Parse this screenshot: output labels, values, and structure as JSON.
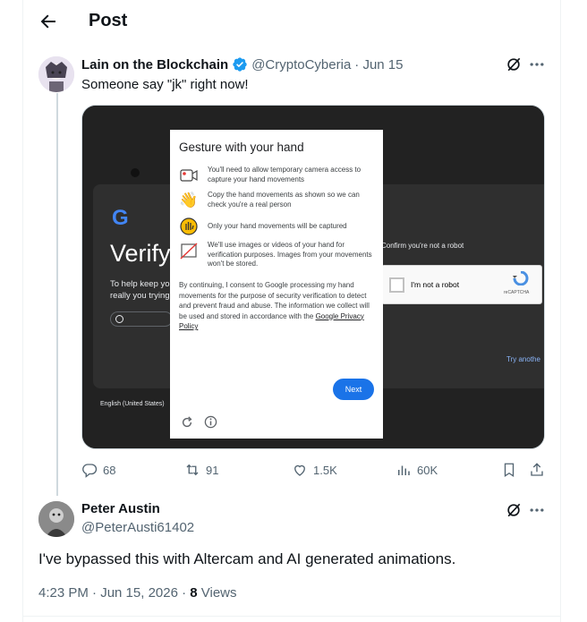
{
  "header": {
    "title": "Post"
  },
  "tweet": {
    "author_name": "Lain on the Blockchain",
    "author_handle": "@CryptoCyberia",
    "date": "· Jun 15",
    "text": "Someone say \"jk\" right now!",
    "stats": {
      "replies": "68",
      "retweets": "91",
      "likes": "1.5K",
      "views": "60K"
    }
  },
  "media": {
    "google_title": "Verify",
    "help_line1": "To help keep yo",
    "help_line2": "really you trying",
    "footer_lang": "English (United States)",
    "confirm_text": "Confirm you're not a robot",
    "captcha_label": "I'm not a robot",
    "captcha_brand": "reCAPTCHA",
    "try_another": "Try anothe",
    "dialog": {
      "title": "Gesture with your hand",
      "rows": [
        "You'll need to allow temporary camera access to capture your hand movements",
        "Copy the hand movements as shown so we can check you're a real person",
        "Only your hand movements will be captured",
        "We'll use images or videos of your hand for verification purposes. Images from your movements won't be stored."
      ],
      "consent": "By continuing, I consent to Google processing my hand movements for the purpose of security verification to detect and prevent fraud and abuse. The information we collect will be used and stored in accordance with the",
      "policy_link": "Google Privacy Policy",
      "next_label": "Next"
    }
  },
  "reply": {
    "author_name": "Peter Austin",
    "author_handle": "@PeterAusti61402",
    "text": "I've bypassed this with Altercam and AI generated animations.",
    "time": "4:23 PM · Jun 15, 2026 · ",
    "views_count": "8",
    "views_label": " Views"
  },
  "colors": {
    "accent": "#1d9bf0",
    "verified": "#1d9bf0",
    "google_blue": "#1a73e8"
  }
}
